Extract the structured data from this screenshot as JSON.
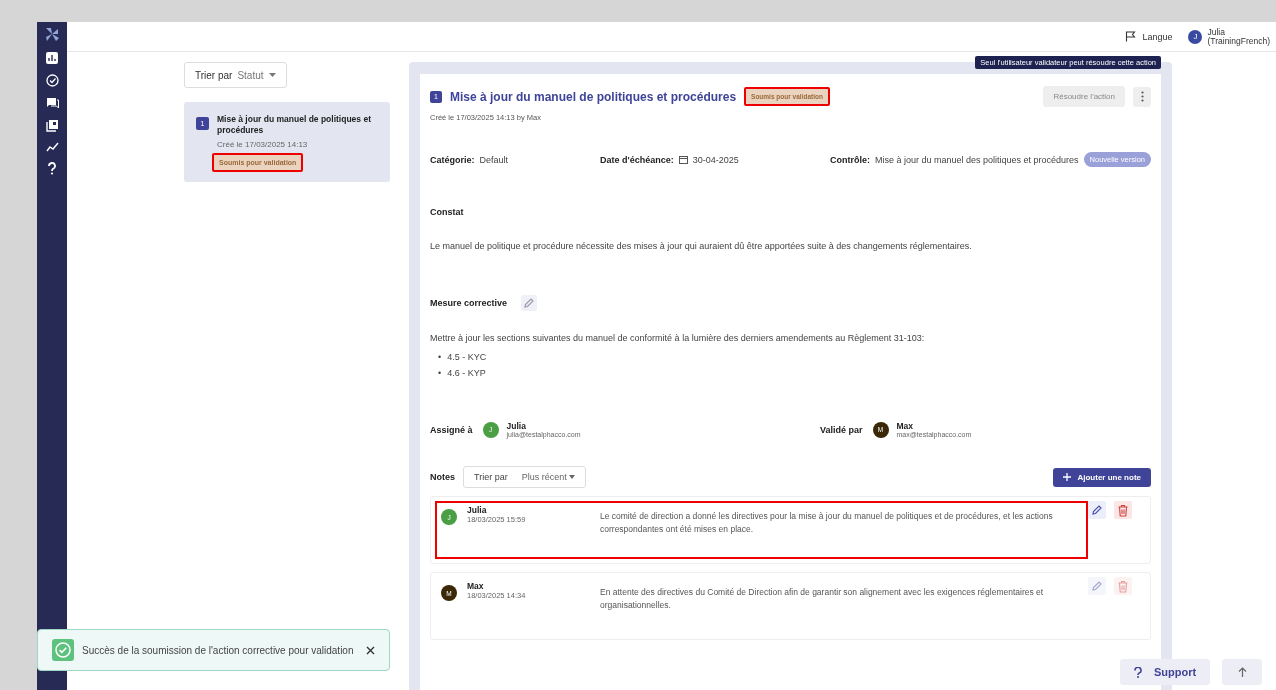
{
  "top_bar": {
    "language": "Langue",
    "user": {
      "initial": "J",
      "name": "Julia",
      "detail": "(TrainingFrench)"
    }
  },
  "action_list": {
    "sort": {
      "label": "Trier par",
      "value": "Statut"
    },
    "items": [
      {
        "number": "1",
        "title": "Mise à jour du manuel de politiques et procédures",
        "created": "Créé le 17/03/2025 14:13",
        "status": "Soumis pour validation",
        "highlighted": true,
        "selected": true
      }
    ]
  },
  "detail": {
    "tooltip": "Seul l'utilisateur validateur peut résoudre cette action",
    "number": "1",
    "title": "Mise à jour du manuel de politiques et procédures",
    "status": "Soumis pour validation",
    "status_highlighted": true,
    "created": "Créé le 17/03/2025 14:13 by Max",
    "resolve_button": {
      "label": "Résoudre l'action",
      "disabled": true
    },
    "fields": [
      {
        "kind": "text",
        "label": "Catégorie:",
        "value": "Default"
      },
      {
        "kind": "date",
        "label": "Date d'échéance:",
        "value": "30-04-2025"
      },
      {
        "kind": "badge",
        "label": "Contrôle:",
        "value": "Mise à jour du manuel des politiques et procédures",
        "badge": "Nouvelle version"
      }
    ],
    "finding": {
      "heading": "Constat",
      "text": "Le manuel de politique et procédure nécessite des mises à jour qui auraient dû être apportées suite à des changements réglementaires."
    },
    "corrective": {
      "heading": "Mesure corrective",
      "text": "Mettre à jour les sections suivantes du manuel de conformité à la lumière des derniers amendements au Règlement 31-103:",
      "bullets": [
        {
          "marker": "•",
          "text": "4.5 - KYC"
        },
        {
          "marker": "•",
          "text": "4.6 - KYP"
        }
      ]
    },
    "people": [
      {
        "label": "Assigné à",
        "initial": "J",
        "name": "Julia",
        "email": "julia@testalphacco.com",
        "color": "#4a9e44"
      },
      {
        "label": "Validé par",
        "initial": "M",
        "name": "Max",
        "email": "max@testalphacco.com",
        "color": "#3a2808"
      }
    ]
  },
  "notes": {
    "heading": "Notes",
    "sort": {
      "label": "Trier par",
      "value": "Plus récent"
    },
    "add_button": "Ajouter une note",
    "items": [
      {
        "initial": "J",
        "author": "Julia",
        "color": "#4a9e44",
        "date": "18/03/2025 15:59",
        "text": "Le comité de direction a donné les directives pour la mise à jour du manuel de politiques et de procédures, et les actions correspondantes ont été mises en place.",
        "highlighted": true,
        "actions_disabled": false
      },
      {
        "initial": "M",
        "author": "Max",
        "color": "#3a2808",
        "date": "18/03/2025 14:34",
        "text": "En attente des directives du Comité de Direction afin de garantir son alignement avec les exigences réglementaires et organisationnelles.",
        "highlighted": false,
        "actions_disabled": true
      }
    ]
  },
  "toast": {
    "kind": "success",
    "message": "Succès de la soumission de l'action corrective pour validation"
  },
  "support_button": "Support"
}
